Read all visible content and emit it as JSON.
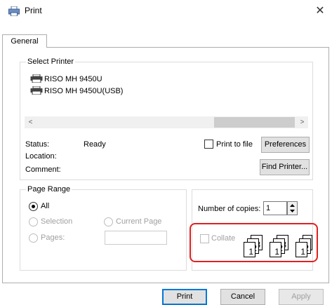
{
  "window": {
    "title": "Print",
    "close_glyph": "✕"
  },
  "tabs": [
    {
      "label": "General",
      "active": true
    }
  ],
  "select_printer": {
    "legend": "Select Printer",
    "printers": [
      {
        "name": "RISO MH 9450U",
        "icon": "printer-icon"
      },
      {
        "name": "RISO MH 9450U(USB)",
        "icon": "printer-icon"
      }
    ],
    "scroll_left_glyph": "<",
    "scroll_right_glyph": ">",
    "status_label": "Status:",
    "status_value": "Ready",
    "location_label": "Location:",
    "comment_label": "Comment:",
    "print_to_file_label": "Print to file",
    "preferences_label": "Preferences",
    "find_printer_label": "Find Printer..."
  },
  "page_range": {
    "legend": "Page Range",
    "all_label": "All",
    "selection_label": "Selection",
    "current_page_label": "Current Page",
    "pages_label": "Pages:",
    "pages_value": ""
  },
  "copies": {
    "number_label": "Number of copies:",
    "number_value": "1",
    "collate_label": "Collate",
    "collate_checked": false,
    "illustration_pages": [
      "3",
      "2",
      "1",
      "3",
      "2",
      "1",
      "3",
      "2",
      "1"
    ]
  },
  "buttons": {
    "print": "Print",
    "cancel": "Cancel",
    "apply": "Apply"
  },
  "colors": {
    "highlight": "#e02020",
    "default_button_border": "#0078d7"
  }
}
